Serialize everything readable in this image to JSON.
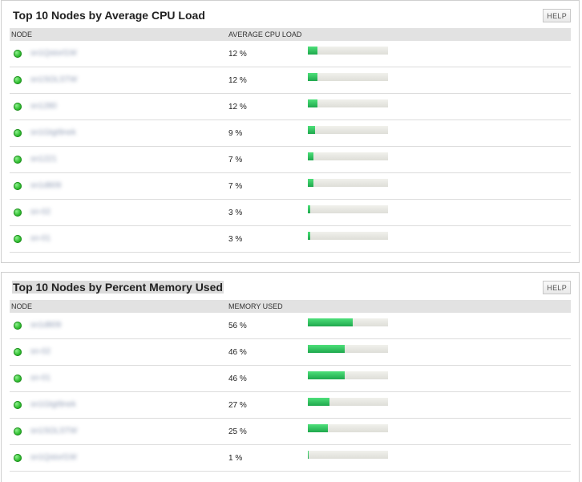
{
  "cpu": {
    "title": "Top 10 Nodes by Average CPU Load",
    "help_label": "HELP",
    "columns": {
      "node": "NODE",
      "value": "AVERAGE CPU LOAD"
    },
    "rows": [
      {
        "node": "sn1Qstorl1W",
        "value_text": "12 %",
        "percent": 12
      },
      {
        "node": "sn1SOLSTW",
        "value_text": "12 %",
        "percent": 12
      },
      {
        "node": "sn1280",
        "value_text": "12 %",
        "percent": 12
      },
      {
        "node": "sn1Gtgt9nek",
        "value_text": "9 %",
        "percent": 9
      },
      {
        "node": "sn1221",
        "value_text": "7 %",
        "percent": 7
      },
      {
        "node": "sn1d809",
        "value_text": "7 %",
        "percent": 7
      },
      {
        "node": "sn-02",
        "value_text": "3 %",
        "percent": 3
      },
      {
        "node": "sn-01",
        "value_text": "3 %",
        "percent": 3
      }
    ]
  },
  "memory": {
    "title": "Top 10 Nodes by Percent Memory Used",
    "help_label": "HELP",
    "columns": {
      "node": "NODE",
      "value": "MEMORY USED"
    },
    "rows": [
      {
        "node": "sn1d809",
        "value_text": "56 %",
        "percent": 56
      },
      {
        "node": "sn-02",
        "value_text": "46 %",
        "percent": 46
      },
      {
        "node": "sn-01",
        "value_text": "46 %",
        "percent": 46
      },
      {
        "node": "sn1Gtgt9nek",
        "value_text": "27 %",
        "percent": 27
      },
      {
        "node": "sn1SOLSTW",
        "value_text": "25 %",
        "percent": 25
      },
      {
        "node": "sn1Qstorl1W",
        "value_text": "1 %",
        "percent": 1
      }
    ]
  },
  "colors": {
    "bar_fill": "#2ec35d",
    "bar_track": "#e6e6e0",
    "status_up": "#2ebd2e"
  },
  "icons": {
    "status": "status-up-icon"
  }
}
